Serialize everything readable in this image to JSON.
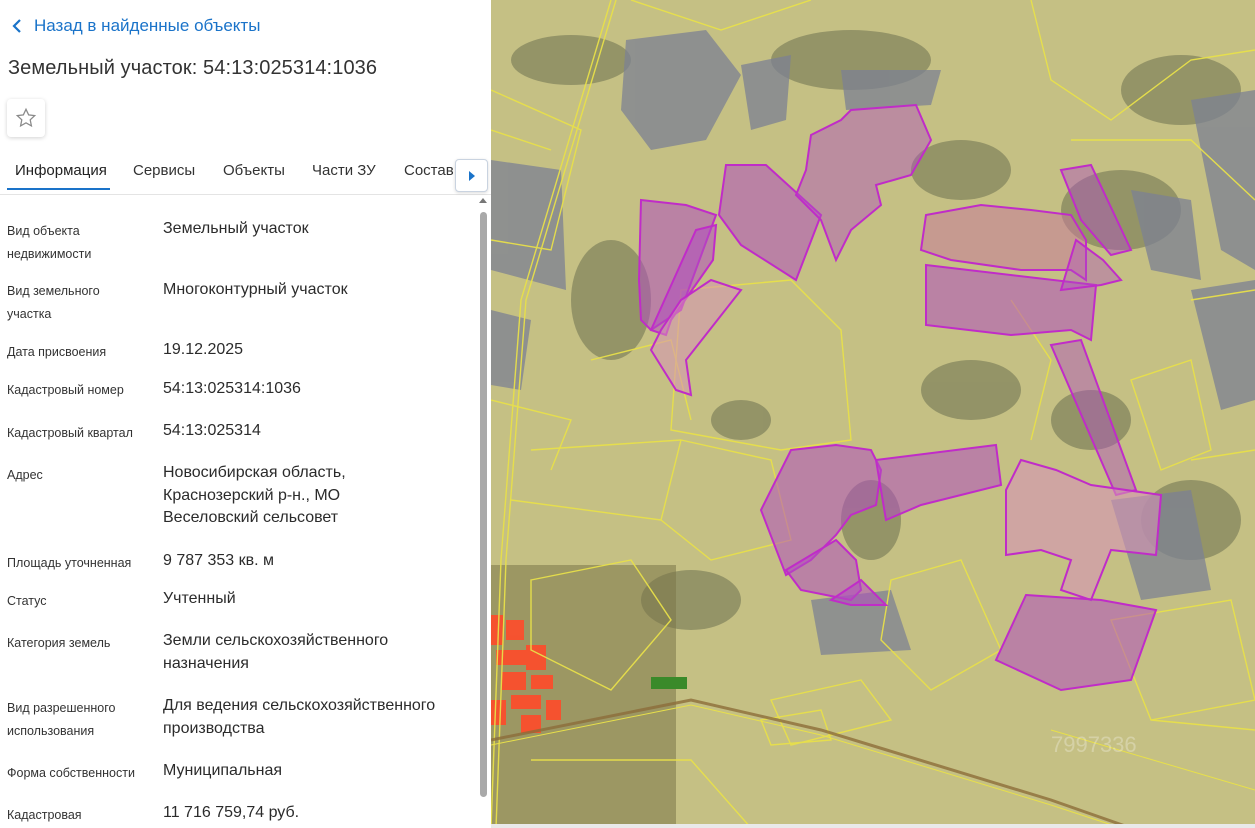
{
  "header": {
    "back_label": "Назад в найденные объекты",
    "title": "Земельный участок: 54:13:025314:1036"
  },
  "tabs": [
    {
      "label": "Информация",
      "active": true
    },
    {
      "label": "Сервисы",
      "active": false
    },
    {
      "label": "Объекты",
      "active": false
    },
    {
      "label": "Части ЗУ",
      "active": false
    },
    {
      "label": "Состав",
      "active": false
    }
  ],
  "info": {
    "object_type": {
      "label": [
        "Вид объекта",
        "недвижимости"
      ],
      "value": "Земельный участок"
    },
    "land_type": {
      "label": [
        "Вид земельного",
        "участка"
      ],
      "value": "Многоконтурный участок"
    },
    "date_assigned": {
      "label": "Дата присвоения",
      "value": "19.12.2025"
    },
    "cadastral_number": {
      "label": "Кадастровый номер",
      "value": "54:13:025314:1036"
    },
    "cadastral_block": {
      "label": "Кадастровый квартал",
      "value": "54:13:025314"
    },
    "address": {
      "label": "Адрес",
      "value": [
        "Новосибирская область,",
        "Краснозерский р-н., МО",
        "Веселовский сельсовет"
      ]
    },
    "area": {
      "label": "Площадь уточненная",
      "value": "9 787 353 кв. м"
    },
    "status": {
      "label": "Статус",
      "value": "Учтенный"
    },
    "category": {
      "label": "Категория земель",
      "value": [
        "Земли сельскохозяйственного",
        "назначения"
      ]
    },
    "permitted_use": {
      "label": [
        "Вид разрешенного",
        "использования"
      ],
      "value": [
        "Для ведения сельскохозяйственного",
        "производства"
      ]
    },
    "ownership": {
      "label": "Форма собственности",
      "value": "Муниципальная"
    },
    "cadastral_value": {
      "label": "Кадастровая",
      "value": "11 716 759,74 руб."
    }
  },
  "icons": {
    "back": "chevron-left-icon",
    "favorite": "star-outline-icon",
    "tabs_next": "triangle-right-icon"
  },
  "colors": {
    "accent": "#1a73c9",
    "parcel_fill": "#b04fc0",
    "parcel_stroke": "#c02cc8",
    "boundary": "#e8e04a",
    "selected_settlement": "#ff4b2a"
  },
  "map": {
    "watermark": "7997336"
  }
}
